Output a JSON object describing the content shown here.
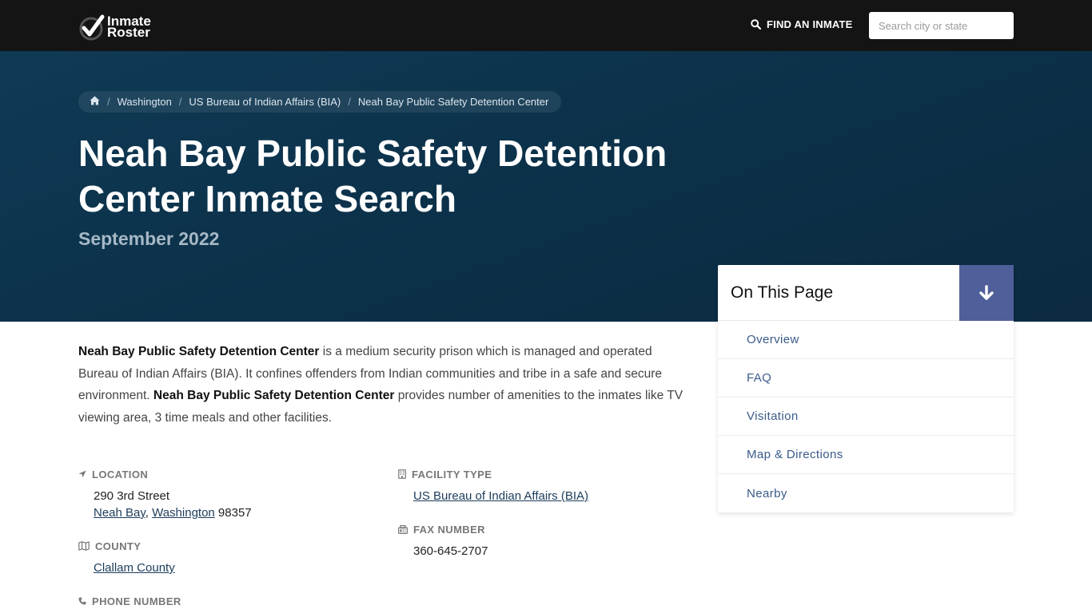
{
  "nav": {
    "logo_line1": "Inmate",
    "logo_line2": "Roster",
    "find_label": "FIND AN INMATE",
    "search_placeholder": "Search city or state"
  },
  "breadcrumb": {
    "items": [
      "Washington",
      "US Bureau of Indian Affairs (BIA)",
      "Neah Bay Public Safety Detention Center"
    ]
  },
  "hero": {
    "title": "Neah Bay Public Safety Detention Center Inmate Search",
    "date": "September 2022"
  },
  "toc": {
    "title": "On This Page",
    "items": [
      "Overview",
      "FAQ",
      "Visitation",
      "Map & Directions",
      "Nearby"
    ]
  },
  "intro": {
    "facility_name": "Neah Bay Public Safety Detention Center",
    "part1": " is a medium security prison which is managed and operated Bureau of Indian Affairs (BIA). It confines offenders from Indian communities and tribe in a safe and secure environment. ",
    "part2": " provides number of amenities to the inmates like TV viewing area, 3 time meals and other facilities."
  },
  "fields": {
    "location": {
      "label": "LOCATION",
      "street": "290 3rd Street",
      "city": "Neah Bay",
      "sep": ", ",
      "state": "Washington",
      "zip": " 98357"
    },
    "county": {
      "label": "COUNTY",
      "value": "Clallam County"
    },
    "phone": {
      "label": "PHONE NUMBER"
    },
    "facility_type": {
      "label": "FACILITY TYPE",
      "value": "US Bureau of Indian Affairs (BIA)"
    },
    "fax": {
      "label": "FAX NUMBER",
      "value": "360-645-2707"
    }
  },
  "icons": {
    "home": "home-icon",
    "search": "search-icon",
    "arrow": "arrow-down-icon",
    "location": "location-arrow-icon",
    "county": "map-icon",
    "phone": "phone-icon",
    "facility": "building-icon",
    "fax": "fax-icon"
  },
  "colors": {
    "topbar": "#141414",
    "hero": "#0f3a55",
    "toc_button": "#4f5f9a",
    "toc_link": "#3a5a8a"
  }
}
